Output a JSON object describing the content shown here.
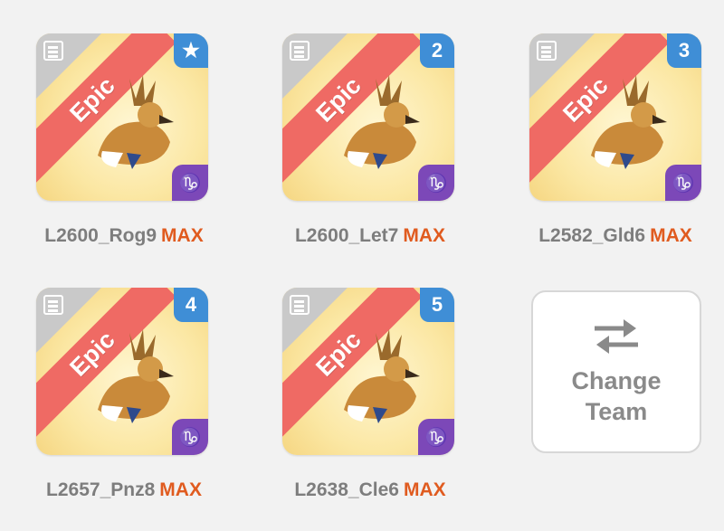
{
  "cards": [
    {
      "rarity": "Epic",
      "badge": "★",
      "badge_type": "star",
      "name": "L2600_Rog9",
      "max": "MAX"
    },
    {
      "rarity": "Epic",
      "badge": "2",
      "badge_type": "number",
      "name": "L2600_Let7",
      "max": "MAX"
    },
    {
      "rarity": "Epic",
      "badge": "3",
      "badge_type": "number",
      "name": "L2582_Gld6",
      "max": "MAX"
    },
    {
      "rarity": "Epic",
      "badge": "4",
      "badge_type": "number",
      "name": "L2657_Pnz8",
      "max": "MAX"
    },
    {
      "rarity": "Epic",
      "badge": "5",
      "badge_type": "number",
      "name": "L2638_Cle6",
      "max": "MAX"
    }
  ],
  "class_icon": "capricorn-icon",
  "change_team": {
    "line1": "Change",
    "line2": "Team",
    "icon": "swap-arrows-icon"
  },
  "colors": {
    "epic": "#ef6a64",
    "badge": "#3f8ed6",
    "class": "#7c48b8",
    "max": "#e05b1f"
  }
}
